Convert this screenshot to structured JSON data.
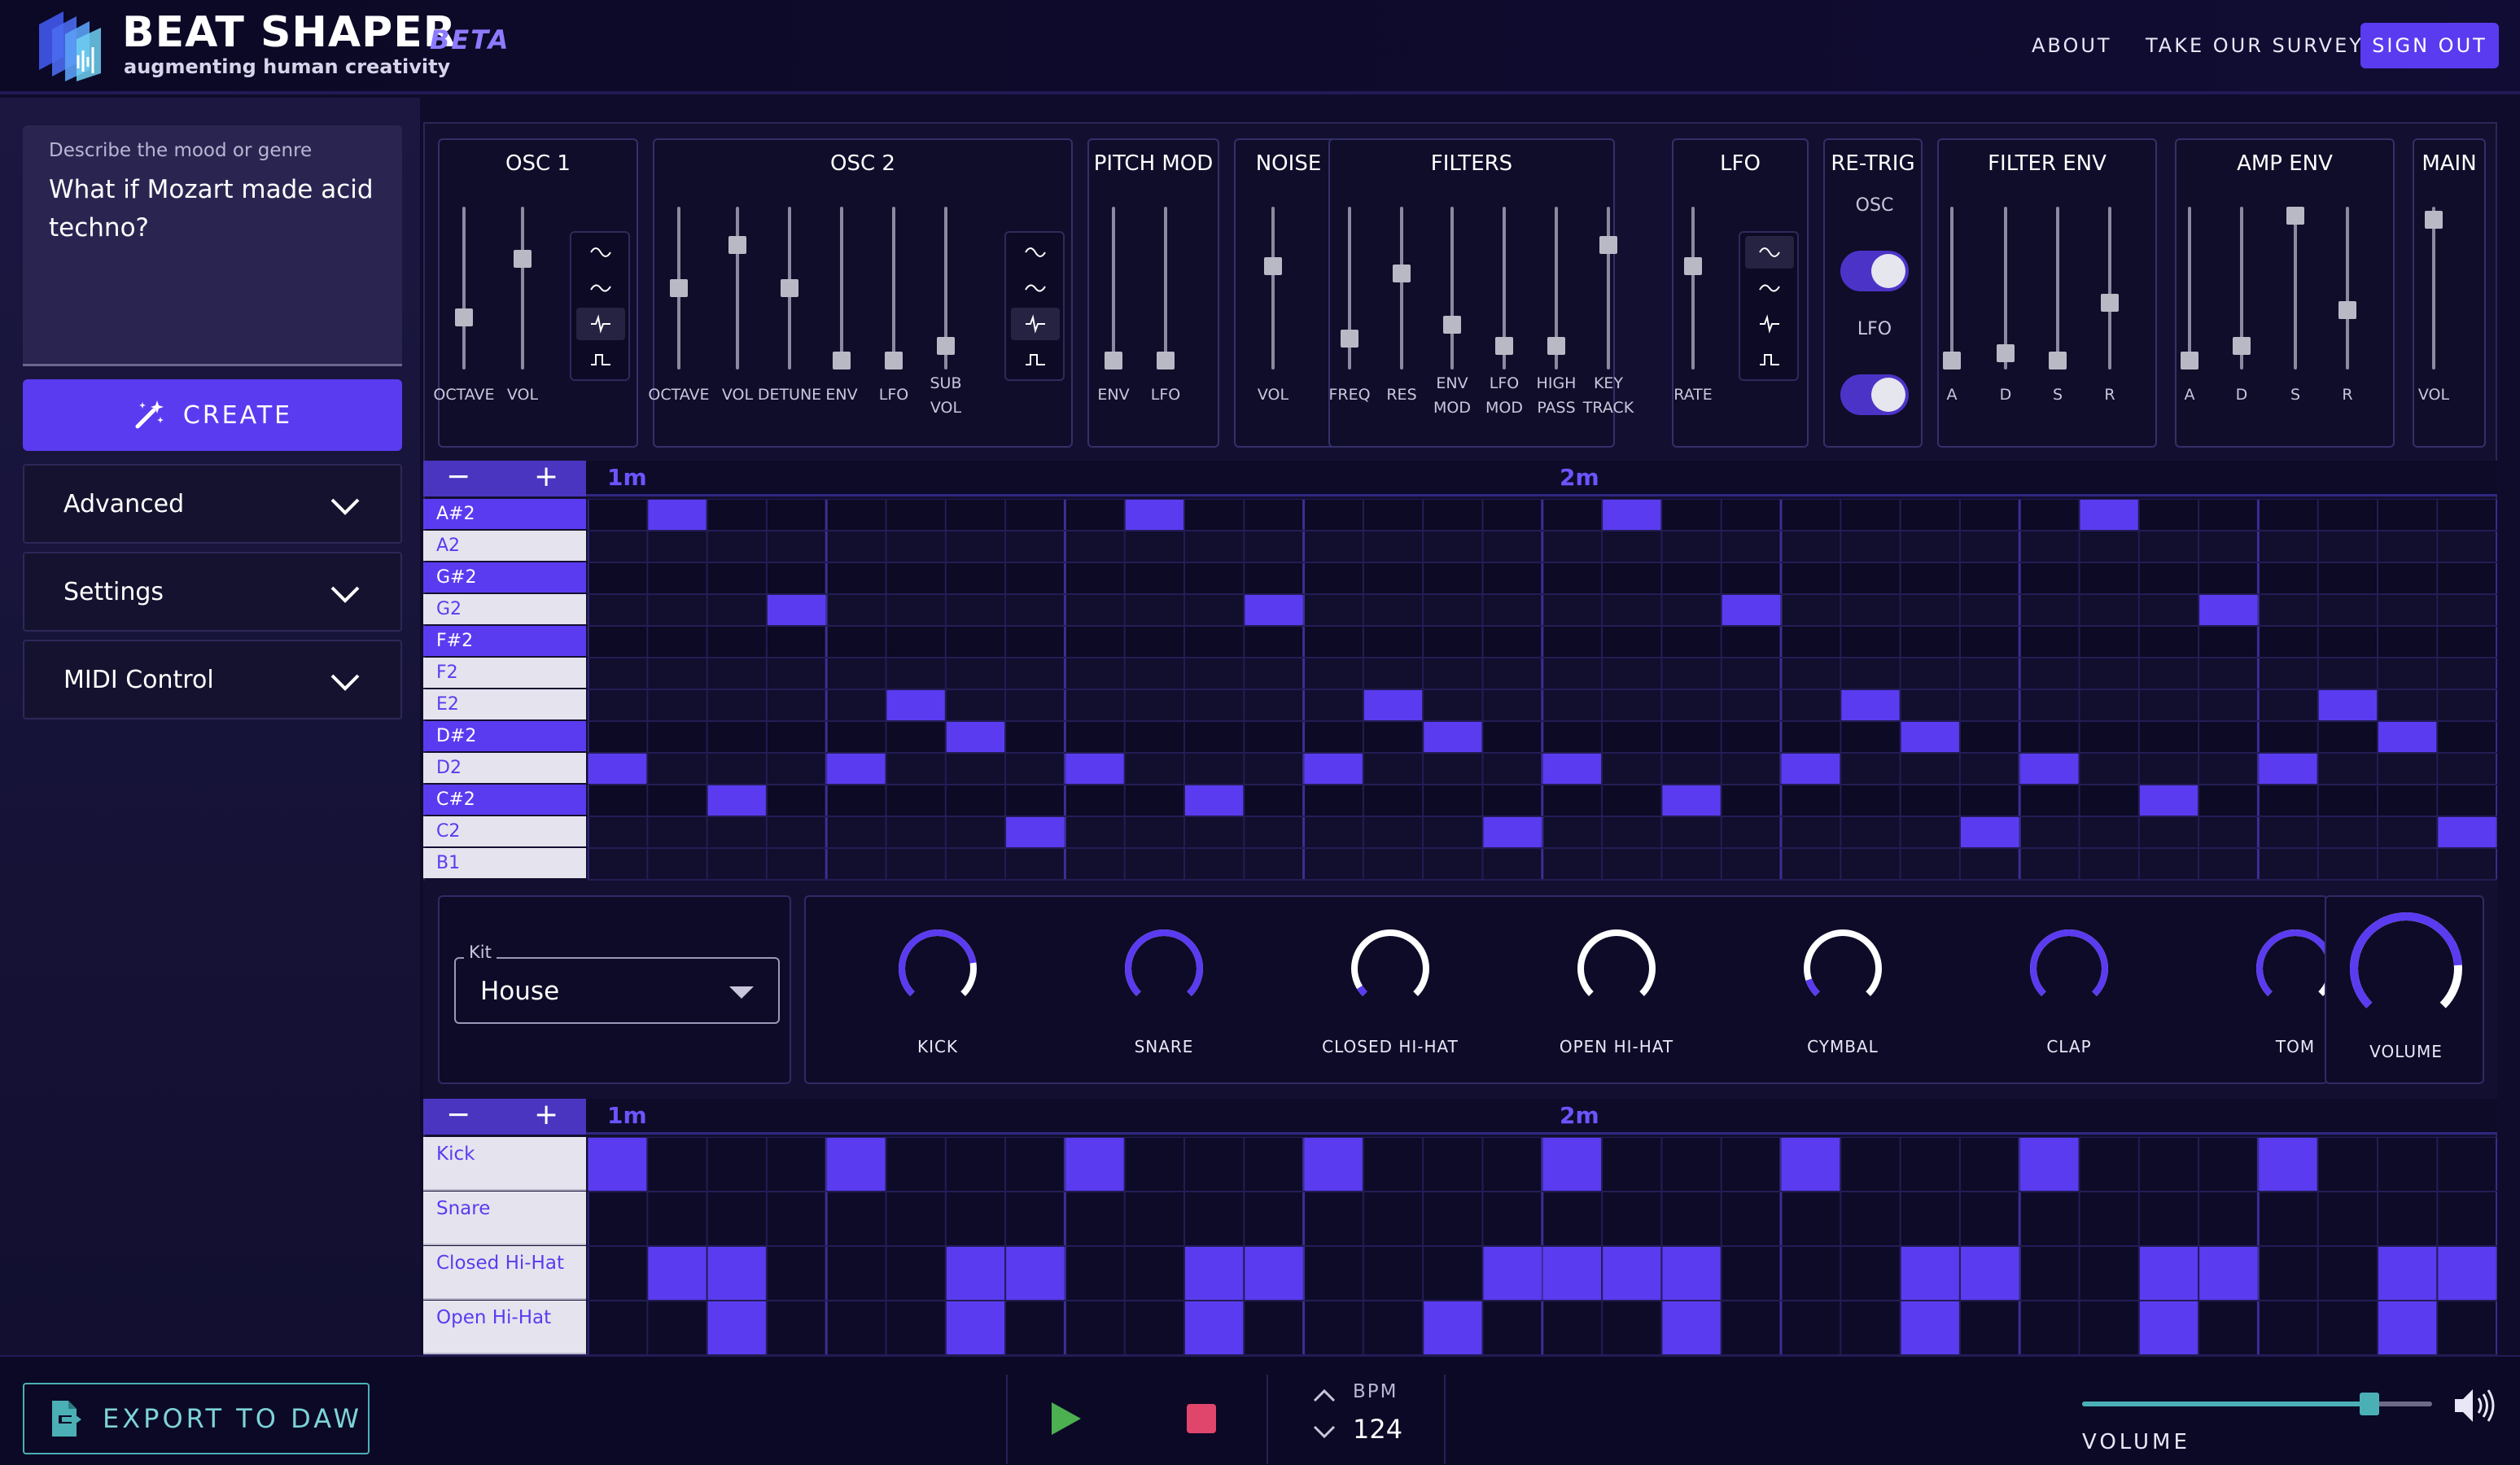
{
  "header": {
    "brand": "BEAT SHAPER",
    "beta": "BETA",
    "tagline": "augmenting human creativity",
    "nav": {
      "about": "ABOUT",
      "survey": "TAKE OUR SURVEY",
      "sign_out": "SIGN OUT"
    }
  },
  "sidebar": {
    "prompt_label": "Describe the mood or genre",
    "prompt_value": "What if Mozart made acid techno?",
    "create_label": "CREATE",
    "accordions": [
      "Advanced",
      "Settings",
      "MIDI Control"
    ]
  },
  "synth": {
    "modules": [
      {
        "title": "OSC 1",
        "sliders": [
          {
            "label": "OCTAVE",
            "value": 0.3
          },
          {
            "label": "VOL",
            "value": 0.7
          }
        ],
        "waves": true,
        "wave_selected": 2
      },
      {
        "title": "OSC 2",
        "sliders": [
          {
            "label": "OCTAVE",
            "value": 0.5
          },
          {
            "label": "VOL",
            "value": 0.8
          },
          {
            "label": "DETUNE",
            "value": 0.5
          },
          {
            "label": "ENV",
            "value": 0.0
          },
          {
            "label": "LFO",
            "value": 0.0
          },
          {
            "label": "SUB VOL",
            "value": 0.1
          }
        ],
        "waves": true,
        "wave_selected": 2
      },
      {
        "title": "PITCH MOD",
        "sliders": [
          {
            "label": "ENV",
            "value": 0.0
          },
          {
            "label": "LFO",
            "value": 0.0
          }
        ]
      },
      {
        "title": "NOISE",
        "sliders": [
          {
            "label": "VOL",
            "value": 0.65
          }
        ]
      },
      {
        "title": "FILTERS",
        "sliders": [
          {
            "label": "FREQ",
            "value": 0.15
          },
          {
            "label": "RES",
            "value": 0.6
          },
          {
            "label": "ENV MOD",
            "value": 0.25
          },
          {
            "label": "LFO MOD",
            "value": 0.1
          },
          {
            "label": "HIGH PASS",
            "value": 0.1
          },
          {
            "label": "KEY TRACK",
            "value": 0.8
          }
        ]
      },
      {
        "title": "LFO",
        "sliders": [
          {
            "label": "RATE",
            "value": 0.65
          }
        ],
        "waves": true,
        "wave_selected": 0
      },
      {
        "title": "RE-TRIG",
        "toggles": [
          {
            "label": "OSC",
            "on": true
          },
          {
            "label": "LFO",
            "on": true
          }
        ]
      },
      {
        "title": "FILTER ENV",
        "sliders": [
          {
            "label": "A",
            "value": 0.0
          },
          {
            "label": "D",
            "value": 0.05
          },
          {
            "label": "S",
            "value": 0.0
          },
          {
            "label": "R",
            "value": 0.4
          }
        ]
      },
      {
        "title": "AMP ENV",
        "sliders": [
          {
            "label": "A",
            "value": 0.0
          },
          {
            "label": "D",
            "value": 0.1
          },
          {
            "label": "S",
            "value": 1.0
          },
          {
            "label": "R",
            "value": 0.35
          }
        ]
      },
      {
        "title": "MAIN",
        "sliders": [
          {
            "label": "VOL",
            "value": 0.97
          }
        ]
      }
    ]
  },
  "piano_roll": {
    "zoom_minus": "−",
    "zoom_plus": "+",
    "markers": [
      "1m",
      "2m"
    ],
    "keys": [
      "A#2",
      "A2",
      "G#2",
      "G2",
      "F#2",
      "F2",
      "E2",
      "D#2",
      "D2",
      "C#2",
      "C2",
      "B1"
    ],
    "black_keys": [
      "A#2",
      "G#2",
      "F#2",
      "D#2",
      "C#2"
    ],
    "notes": [
      {
        "step": 0,
        "key": "D2"
      },
      {
        "step": 1,
        "key": "A#2"
      },
      {
        "step": 2,
        "key": "C#2"
      },
      {
        "step": 3,
        "key": "G2"
      },
      {
        "step": 4,
        "key": "D2"
      },
      {
        "step": 5,
        "key": "E2"
      },
      {
        "step": 6,
        "key": "D#2"
      },
      {
        "step": 7,
        "key": "C2"
      },
      {
        "step": 8,
        "key": "D2"
      },
      {
        "step": 9,
        "key": "A#2"
      },
      {
        "step": 10,
        "key": "C#2"
      },
      {
        "step": 11,
        "key": "G2"
      },
      {
        "step": 12,
        "key": "D2"
      },
      {
        "step": 13,
        "key": "E2"
      },
      {
        "step": 14,
        "key": "D#2"
      },
      {
        "step": 15,
        "key": "C2"
      },
      {
        "step": 16,
        "key": "D2"
      },
      {
        "step": 17,
        "key": "A#2"
      },
      {
        "step": 18,
        "key": "C#2"
      },
      {
        "step": 19,
        "key": "G2"
      },
      {
        "step": 20,
        "key": "D2"
      },
      {
        "step": 21,
        "key": "E2"
      },
      {
        "step": 22,
        "key": "D#2"
      },
      {
        "step": 23,
        "key": "C2"
      },
      {
        "step": 24,
        "key": "D2"
      },
      {
        "step": 25,
        "key": "A#2"
      },
      {
        "step": 26,
        "key": "C#2"
      },
      {
        "step": 27,
        "key": "G2"
      },
      {
        "step": 28,
        "key": "D2"
      },
      {
        "step": 29,
        "key": "E2"
      },
      {
        "step": 30,
        "key": "D#2"
      },
      {
        "step": 31,
        "key": "C2"
      }
    ]
  },
  "drums": {
    "kit_label": "Kit",
    "kit_value": "House",
    "knobs": [
      {
        "label": "KICK",
        "value": 0.8
      },
      {
        "label": "SNARE",
        "value": 1.0
      },
      {
        "label": "CLOSED HI-HAT",
        "value": 0.05
      },
      {
        "label": "OPEN HI-HAT",
        "value": 0.0
      },
      {
        "label": "CYMBAL",
        "value": 0.1
      },
      {
        "label": "CLAP",
        "value": 1.0
      },
      {
        "label": "TOM",
        "value": 0.8
      }
    ],
    "volume_label": "VOLUME",
    "volume_value": 0.82,
    "rows": [
      {
        "name": "Kick",
        "steps": [
          0,
          4,
          8,
          12,
          16,
          20,
          24,
          28
        ]
      },
      {
        "name": "Snare",
        "steps": []
      },
      {
        "name": "Closed Hi-Hat",
        "steps": [
          1,
          2,
          6,
          7,
          10,
          11,
          15,
          16,
          17,
          18,
          22,
          23,
          26,
          27,
          30,
          31
        ]
      },
      {
        "name": "Open Hi-Hat",
        "steps": [
          2,
          6,
          10,
          14,
          18,
          22,
          26,
          30
        ]
      }
    ]
  },
  "transport": {
    "export_label": "EXPORT TO DAW",
    "bpm_label": "BPM",
    "bpm_value": "124",
    "volume_label": "VOLUME",
    "master_volume": 0.82
  },
  "colors": {
    "accent": "#5b3bf0",
    "note": "#5b3bf0",
    "teal": "#4bb0b6",
    "stop": "#e0466b",
    "play": "#4caf50"
  }
}
